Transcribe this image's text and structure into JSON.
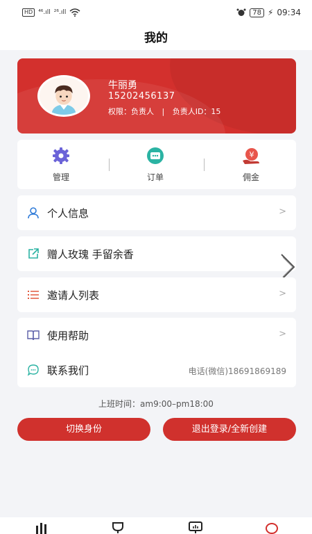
{
  "status_bar": {
    "hd_badge": "HD",
    "sig1": "⁴⁶.ıll",
    "sig2": "²⁶.ıll",
    "battery": "78",
    "time": "09:34"
  },
  "header": {
    "title": "我的"
  },
  "profile": {
    "name": "牛丽勇",
    "phone": "15202456137",
    "permission_label": "权限：负责人",
    "separator": "|",
    "id_label": "负责人ID：15"
  },
  "quick_actions": [
    {
      "label": "管理",
      "icon": "gear-icon",
      "color": "#6b63d8"
    },
    {
      "label": "订单",
      "icon": "order-icon",
      "color": "#2bb3a3"
    },
    {
      "label": "佣金",
      "icon": "commission-icon",
      "color": "#e8554b"
    }
  ],
  "menu": {
    "personal_info": {
      "label": "个人信息",
      "chevron": ">"
    },
    "gift": {
      "label": "赠人玫瑰 手留余香"
    },
    "invite_list": {
      "label": "邀请人列表",
      "chevron": ">"
    },
    "help": {
      "label": "使用帮助",
      "chevron": ">"
    },
    "contact": {
      "label": "联系我们",
      "value": "电话(微信)18691869189"
    }
  },
  "work_time": "上班时间：am9:00–pm18:00",
  "buttons": {
    "switch_identity": "切换身份",
    "logout": "退出登录/全新创建"
  },
  "colors": {
    "brand_red": "#d3302d",
    "page_bg": "#f3f4f7"
  }
}
